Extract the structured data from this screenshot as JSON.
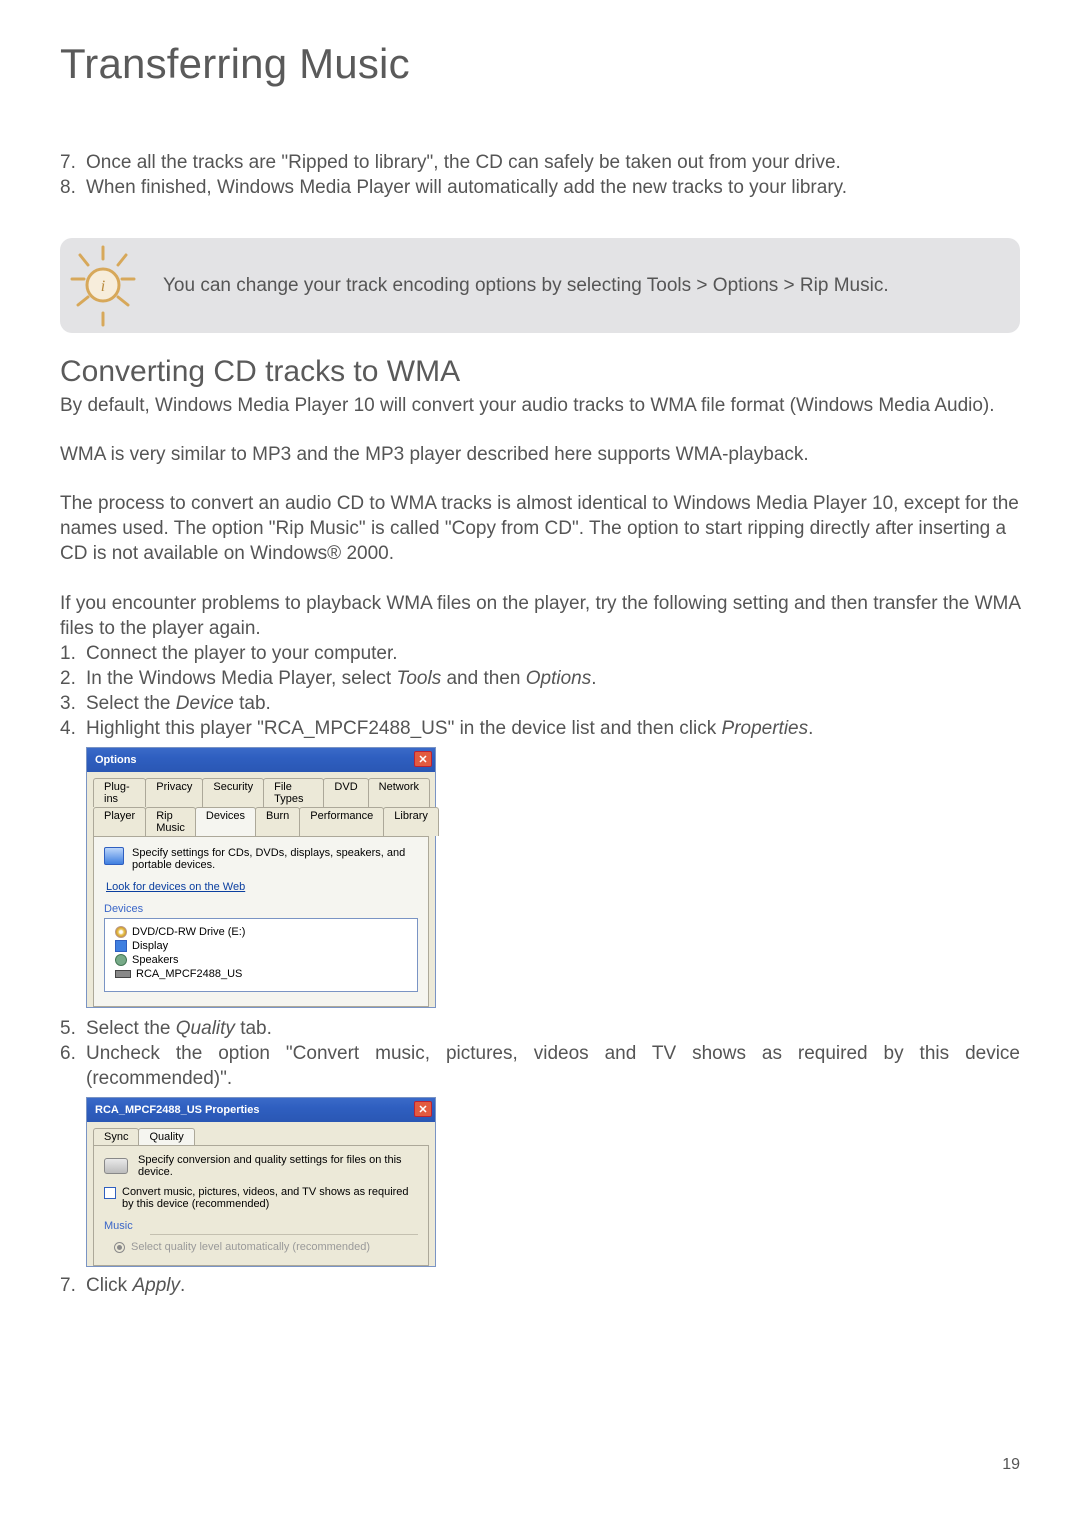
{
  "page_title": "Transferring Music",
  "page_number": "19",
  "intro_steps": [
    {
      "num": "7.",
      "text": "Once all the tracks are \"Ripped to library\", the CD can safely be taken out from your drive."
    },
    {
      "num": "8.",
      "text": "When finished, Windows Media Player will automatically add the new tracks to your library."
    }
  ],
  "tip_text": "You can change your track encoding options by selecting Tools > Options > Rip Music.",
  "section_title": "Converting CD tracks to WMA",
  "para1": "By default, Windows Media Player 10 will convert your audio tracks to WMA file format (Windows Media Audio).",
  "para2": "WMA is very similar to MP3 and the MP3 player described here supports WMA-playback.",
  "para3": "The process to convert an audio CD to WMA tracks is almost identical to Windows Media Player 10, except for the names used. The option \"Rip Music\" is called \"Copy from CD\". The option to start ripping directly after inserting a CD is not available on Windows® 2000.",
  "para4": "If you encounter problems to playback WMA files on the player, try the following setting and then transfer the WMA files to the player again.",
  "steps_a": [
    {
      "num": "1.",
      "pre": "Connect the player to your computer.",
      "italic": "",
      "post": ""
    },
    {
      "num": "2.",
      "pre": "In the Windows Media Player, select ",
      "italic": "Tools",
      "mid": " and then ",
      "italic2": "Options",
      "post": "."
    },
    {
      "num": "3.",
      "pre": "Select the ",
      "italic": "Device",
      "post": " tab."
    },
    {
      "num": "4.",
      "pre": "Highlight this player \"RCA_MPCF2488_US\" in the device list and then click ",
      "italic": "Properties",
      "post": "."
    }
  ],
  "steps_b": [
    {
      "num": "5.",
      "pre": "Select the ",
      "italic": "Quality",
      "post": " tab."
    },
    {
      "num": "6.",
      "pre": "Uncheck the option \"Convert music, pictures, videos and TV shows as required by this device (recommended)\".",
      "italic": "",
      "post": ""
    }
  ],
  "step_c": {
    "num": "7.",
    "pre": "Click ",
    "italic": "Apply",
    "post": "."
  },
  "dialog_options": {
    "title": "Options",
    "tabs_row1": [
      "Plug-ins",
      "Privacy",
      "Security",
      "File Types",
      "DVD",
      "Network"
    ],
    "tabs_row2": [
      "Player",
      "Rip Music",
      "Devices",
      "Burn",
      "Performance",
      "Library"
    ],
    "active_tab": "Devices",
    "desc": "Specify settings for CDs, DVDs, displays, speakers, and portable devices.",
    "link": "Look for devices on the Web",
    "group": "Devices",
    "list": [
      "DVD/CD-RW Drive (E:)",
      "Display",
      "Speakers",
      "RCA_MPCF2488_US"
    ]
  },
  "dialog_props": {
    "title": "RCA_MPCF2488_US Properties",
    "tabs": [
      "Sync",
      "Quality"
    ],
    "active_tab": "Quality",
    "desc": "Specify conversion and quality settings for files on this device.",
    "checkbox": "Convert music, pictures, videos, and TV shows as required by this device (recommended)",
    "group": "Music",
    "radio": "Select quality level automatically (recommended)"
  }
}
